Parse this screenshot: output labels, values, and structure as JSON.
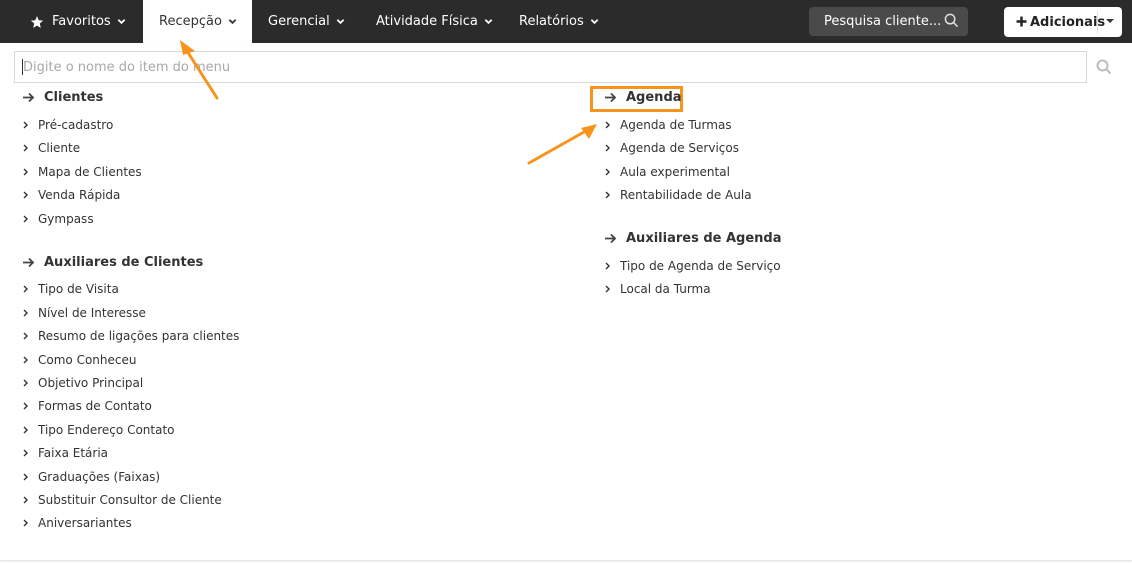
{
  "topbar": {
    "nav": [
      {
        "label": "Favoritos"
      },
      {
        "label": "Recepção"
      },
      {
        "label": "Gerencial"
      },
      {
        "label": "Atividade Física"
      },
      {
        "label": "Relatórios"
      }
    ],
    "search_label": "Pesquisa cliente...",
    "add_label": "Adicionais"
  },
  "menu": {
    "search_placeholder": "Digite o nome do item do menu",
    "sections": [
      {
        "title": "Clientes",
        "items": [
          "Pré-cadastro",
          "Cliente",
          "Mapa de Clientes",
          "Venda Rápida",
          "Gympass"
        ]
      },
      {
        "title": "Auxiliares de Clientes",
        "items": [
          "Tipo de Visita",
          "Nível de Interesse",
          "Resumo de ligações para clientes",
          "Como Conheceu",
          "Objetivo Principal",
          "Formas de Contato",
          "Tipo Endereço Contato",
          "Faixa Etária",
          "Graduações (Faixas)",
          "Substituir Consultor de Cliente",
          "Aniversariantes"
        ]
      },
      {
        "title": "Agenda",
        "items": [
          "Agenda de Turmas",
          "Agenda de Serviços",
          "Aula experimental",
          "Rentabilidade de Aula"
        ]
      },
      {
        "title": "Auxiliares de Agenda",
        "items": [
          "Tipo de Agenda de Serviço",
          "Local da Turma"
        ]
      }
    ]
  },
  "colors": {
    "topbar": "#2b2b2b",
    "annotation": "#f7941d"
  },
  "icons": {
    "favorites": "star-icon",
    "dropdown": "chevron-down-icon",
    "search": "search-icon",
    "add": "plus-icon",
    "section": "arrow-right-icon",
    "item": "chevron-right-icon"
  }
}
